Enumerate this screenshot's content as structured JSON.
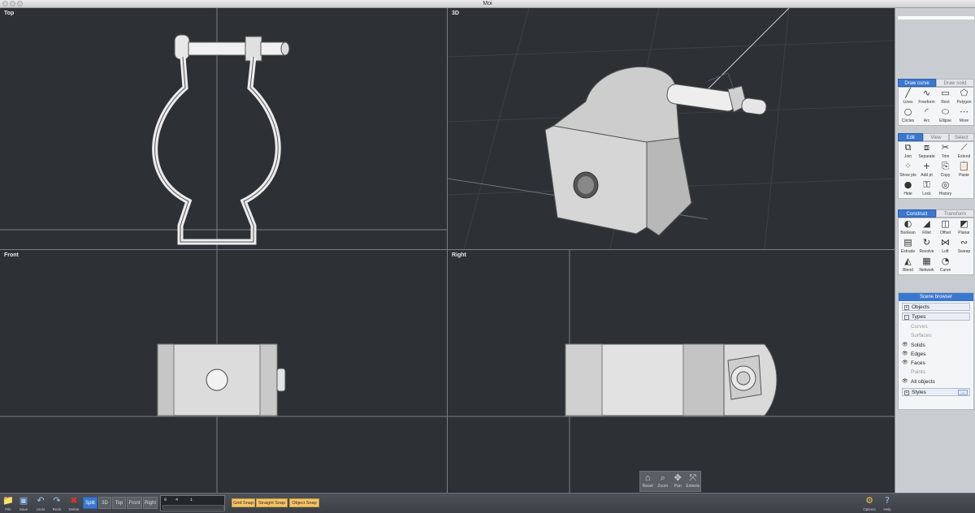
{
  "window": {
    "title": "Moi"
  },
  "viewports": {
    "top": {
      "label": "Top"
    },
    "threed": {
      "label": "3D"
    },
    "front": {
      "label": "Front"
    },
    "right": {
      "label": "Right"
    }
  },
  "view_controls": [
    {
      "label": "Reset",
      "icon": "reset-icon"
    },
    {
      "label": "Zoom",
      "icon": "zoom-icon"
    },
    {
      "label": "Pan",
      "icon": "pan-icon"
    },
    {
      "label": "Extents",
      "icon": "extents-icon"
    }
  ],
  "draw_tabs": {
    "active": "Draw curve",
    "inactive": "Draw solid"
  },
  "draw_tools": [
    {
      "label": "Lines",
      "glyph": "╱"
    },
    {
      "label": "Freeform",
      "glyph": "∿"
    },
    {
      "label": "Rect",
      "glyph": "▭"
    },
    {
      "label": "Polygon",
      "glyph": "⬠"
    },
    {
      "label": "Circles",
      "glyph": "○"
    },
    {
      "label": "Arc",
      "glyph": "◜"
    },
    {
      "label": "Ellipse",
      "glyph": "⬭"
    },
    {
      "label": "More",
      "glyph": "⋯"
    }
  ],
  "edit_tabs": {
    "active": "Edit",
    "others": [
      "View",
      "Select"
    ]
  },
  "edit_tools": [
    {
      "label": "Join",
      "glyph": "⧉"
    },
    {
      "label": "Separate",
      "glyph": "⧈"
    },
    {
      "label": "Trim",
      "glyph": "✂"
    },
    {
      "label": "Extend",
      "glyph": "⟋"
    },
    {
      "label": "Show pts",
      "glyph": "⁘"
    },
    {
      "label": "Add pt",
      "glyph": "+"
    },
    {
      "label": "Copy",
      "glyph": "⎘"
    },
    {
      "label": "Paste",
      "glyph": "📋"
    },
    {
      "label": "Hide",
      "glyph": "●"
    },
    {
      "label": "Lock",
      "glyph": "⚿"
    },
    {
      "label": "History",
      "glyph": "◎"
    }
  ],
  "construct_tabs": {
    "active": "Construct",
    "inactive": "Transform"
  },
  "construct_tools": [
    {
      "label": "Boolean",
      "glyph": "◐"
    },
    {
      "label": "Fillet",
      "glyph": "◢"
    },
    {
      "label": "Offset",
      "glyph": "◫"
    },
    {
      "label": "Planar",
      "glyph": "◩"
    },
    {
      "label": "Extrude",
      "glyph": "▤"
    },
    {
      "label": "Revolve",
      "glyph": "↻"
    },
    {
      "label": "Loft",
      "glyph": "⋈"
    },
    {
      "label": "Sweep",
      "glyph": "∾"
    },
    {
      "label": "Blend",
      "glyph": "◭"
    },
    {
      "label": "Network",
      "glyph": "▦"
    },
    {
      "label": "Curve",
      "glyph": "◔"
    }
  ],
  "scene_browser": {
    "title": "Scene browser",
    "objects": "Objects",
    "types": "Types",
    "curves": "Curves",
    "surfaces": "Surfaces",
    "solids": "Solids",
    "edges": "Edges",
    "faces": "Faces",
    "points": "Points",
    "all_objects": "All objects",
    "styles": "Styles"
  },
  "bottom": {
    "file": "File",
    "save": "Save",
    "undo": "Undo",
    "redo": "Redo",
    "delete": "Delete",
    "views": [
      "Split",
      "3D",
      "Top",
      "Front",
      "Right"
    ],
    "active_view": "Split",
    "coord_x": "0",
    "coord_y": "4",
    "coord_z": "1",
    "snaps": [
      "Grid Snap",
      "Straight Snap",
      "Object Snap"
    ],
    "options": "Options",
    "help": "Help"
  }
}
